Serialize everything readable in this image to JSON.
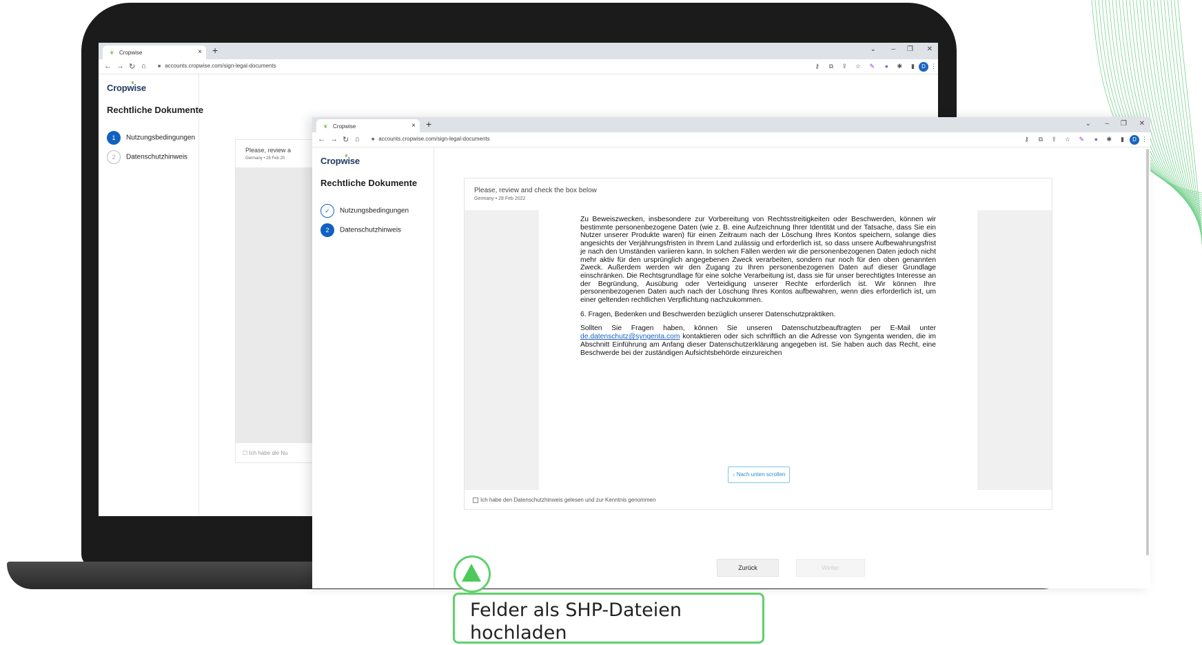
{
  "browser": {
    "tab_title": "Cropwise",
    "favicon": "leaf-icon",
    "new_tab": "+",
    "tab_close": "×",
    "url": "accounts.cropwise.com/sign-legal-documents",
    "profile_initial": "D"
  },
  "app": {
    "logo": "Cropwise",
    "sidebar_title": "Rechtliche Dokumente",
    "steps": [
      {
        "number": "1",
        "label": "Nutzungsbedingungen"
      },
      {
        "number": "2",
        "label": "Datenschutzhinweis"
      }
    ]
  },
  "back_window": {
    "card_header": "Please, review a",
    "card_sub": "Germany • 28 Feb 20",
    "checkbox_label": "Ich habe die Nu"
  },
  "front_window": {
    "card_header": "Please, review and check the box below",
    "card_sub": "Germany • 28 Feb 2022",
    "doc_para1": "Zu Beweiszwecken, insbesondere zur Vorbereitung von Rechtsstreitigkeiten oder Beschwerden, können wir bestimmte personenbezogene Daten (wie z. B. eine Aufzeichnung Ihrer Identität und der Tatsache, dass Sie ein Nutzer unserer Produkte waren) für einen Zeitraum nach der Löschung Ihres Kontos speichern, solange dies angesichts der Verjährungsfristen in Ihrem Land zulässig und erforderlich ist, so dass unsere Aufbewahrungsfrist je nach den Umständen variieren kann. In solchen Fällen werden wir die personenbezogenen Daten jedoch nicht mehr aktiv für den ursprünglich angegebenen Zweck verarbeiten, sondern nur noch für den oben genannten Zweck. Außerdem werden wir den Zugang zu Ihren personenbezogenen Daten auf dieser Grundlage einschränken. Die Rechtsgrundlage für eine solche Verarbeitung ist, dass sie für unser berechtigtes Interesse an der Begründung, Ausübung oder Verteidigung unserer Rechte erforderlich ist.  Wir können Ihre personenbezogenen Daten auch nach der Löschung Ihres Kontos aufbewahren, wenn dies erforderlich ist, um einer geltenden rechtlichen Verpflichtung nachzukommen.",
    "doc_heading6": "6.  Fragen, Bedenken und Beschwerden bezüglich unserer Datenschutzpraktiken.",
    "doc_para2_a": "Sollten Sie Fragen haben, können Sie unseren Datenschutzbeauftragten per E-Mail unter",
    "doc_email": "de.datenschutz@syngenta.com",
    "doc_para2_b": "kontaktieren oder sich schriftlich an die Adresse von Syngenta wenden, die im Abschnitt Einführung am Anfang dieser Datenschutzerklärung angegeben ist. Sie haben auch das Recht, eine Beschwerde bei der zuständigen Aufsichtsbehörde einzureichen",
    "scroll_button": "↓ Nach unten scrollen",
    "checkbox_label": "Ich habe den Datenschutzhinweis gelesen und zur Kenntnis genommen",
    "back_button": "Zurück",
    "next_button": "Weiter"
  },
  "callout": {
    "text": "Felder als SHP-Dateien hochladen"
  },
  "colors": {
    "accent_green": "#5fd06b",
    "step_blue": "#0f62c1",
    "brand_navy": "#1f3a5f"
  }
}
